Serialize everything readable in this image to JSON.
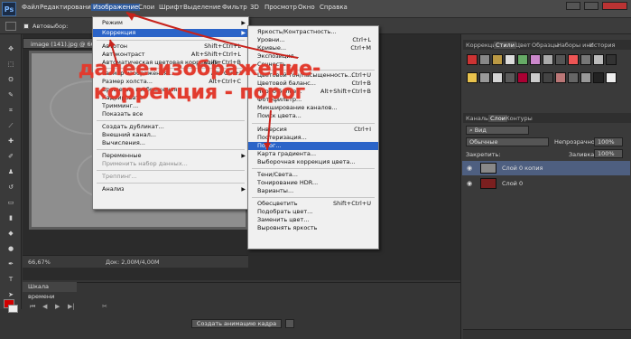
{
  "menubar": {
    "logo": "Ps",
    "items": [
      "Файл",
      "Редактирование",
      "Изображение",
      "Слои",
      "Шрифт",
      "Выделение",
      "Фильтр",
      "3D",
      "Просмотр",
      "Окно",
      "Справка"
    ]
  },
  "options": {
    "auto_select": "Автовыбор:"
  },
  "document": {
    "tab_title": "image (141).jpg @ 66,7",
    "zoom": "66,67%",
    "doc_size": "Док: 2,00М/4,00М"
  },
  "timeline": {
    "title": "Шкала времени",
    "create_button": "Создать анимацию кадра"
  },
  "image_menu": {
    "items": [
      {
        "label": "Режим",
        "shortcut": "",
        "arrow": true,
        "state": "normal"
      },
      {
        "label": "Коррекция",
        "shortcut": "",
        "arrow": true,
        "state": "highlight"
      },
      {
        "label": "Автотон",
        "shortcut": "Shift+Ctrl+L",
        "arrow": false,
        "state": "normal"
      },
      {
        "label": "Автоконтраст",
        "shortcut": "Alt+Shift+Ctrl+L",
        "arrow": false,
        "state": "normal"
      },
      {
        "label": "Автоматическая цветовая коррекция",
        "shortcut": "Shift+Ctrl+B",
        "arrow": false,
        "state": "normal"
      },
      {
        "label": "Размер изображения...",
        "shortcut": "Alt+Ctrl+I",
        "arrow": false,
        "state": "normal"
      },
      {
        "label": "Размер холста...",
        "shortcut": "Alt+Ctrl+C",
        "arrow": false,
        "state": "normal"
      },
      {
        "label": "Вращение изображения",
        "shortcut": "",
        "arrow": true,
        "state": "normal"
      },
      {
        "label": "Кадрировать",
        "shortcut": "",
        "arrow": false,
        "state": "normal"
      },
      {
        "label": "Тримминг...",
        "shortcut": "",
        "arrow": false,
        "state": "normal"
      },
      {
        "label": "Показать все",
        "shortcut": "",
        "arrow": false,
        "state": "normal"
      },
      {
        "label": "Создать дубликат...",
        "shortcut": "",
        "arrow": false,
        "state": "normal"
      },
      {
        "label": "Внешний канал...",
        "shortcut": "",
        "arrow": false,
        "state": "normal"
      },
      {
        "label": "Вычисления...",
        "shortcut": "",
        "arrow": false,
        "state": "normal"
      },
      {
        "label": "Переменные",
        "shortcut": "",
        "arrow": true,
        "state": "normal"
      },
      {
        "label": "Применить набор данных...",
        "shortcut": "",
        "arrow": false,
        "state": "disabled"
      },
      {
        "label": "Треппинг...",
        "shortcut": "",
        "arrow": false,
        "state": "disabled"
      },
      {
        "label": "Анализ",
        "shortcut": "",
        "arrow": true,
        "state": "normal"
      }
    ]
  },
  "correction_menu": {
    "items": [
      {
        "label": "Яркость/Контрастность...",
        "shortcut": "",
        "state": "normal"
      },
      {
        "label": "Уровни...",
        "shortcut": "Ctrl+L",
        "state": "normal"
      },
      {
        "label": "Кривые...",
        "shortcut": "Ctrl+M",
        "state": "normal"
      },
      {
        "label": "Экспозиция...",
        "shortcut": "",
        "state": "normal"
      },
      {
        "label": "Сочность...",
        "shortcut": "",
        "state": "normal"
      },
      {
        "label": "Цветовой тон/Насыщенность...",
        "shortcut": "Ctrl+U",
        "state": "normal"
      },
      {
        "label": "Цветовой баланс...",
        "shortcut": "Ctrl+B",
        "state": "normal"
      },
      {
        "label": "Черно-белое...",
        "shortcut": "Alt+Shift+Ctrl+B",
        "state": "normal"
      },
      {
        "label": "Фотофильтр...",
        "shortcut": "",
        "state": "normal"
      },
      {
        "label": "Микширование каналов...",
        "shortcut": "",
        "state": "normal"
      },
      {
        "label": "Поиск цвета...",
        "shortcut": "",
        "state": "normal"
      },
      {
        "label": "Инверсия",
        "shortcut": "Ctrl+I",
        "state": "normal"
      },
      {
        "label": "Постеризация...",
        "shortcut": "",
        "state": "normal"
      },
      {
        "label": "Порог...",
        "shortcut": "",
        "state": "highlight"
      },
      {
        "label": "Карта градиента...",
        "shortcut": "",
        "state": "normal"
      },
      {
        "label": "Выборочная коррекция цвета...",
        "shortcut": "",
        "state": "normal"
      },
      {
        "label": "Тени/Света...",
        "shortcut": "",
        "state": "normal"
      },
      {
        "label": "Тонирование HDR...",
        "shortcut": "",
        "state": "normal"
      },
      {
        "label": "Варианты...",
        "shortcut": "",
        "state": "normal"
      },
      {
        "label": "Обесцветить",
        "shortcut": "Shift+Ctrl+U",
        "state": "normal"
      },
      {
        "label": "Подобрать цвет...",
        "shortcut": "",
        "state": "normal"
      },
      {
        "label": "Заменить цвет...",
        "shortcut": "",
        "state": "normal"
      },
      {
        "label": "Выровнять яркость",
        "shortcut": "",
        "state": "normal"
      }
    ]
  },
  "annotation": {
    "text": "далее-изображение-коррекция - порог",
    "color": "#e23b2e"
  },
  "styles_panel": {
    "tabs": [
      "Коррекция",
      "Стили",
      "Цвет",
      "Образцы",
      "Наборы инс",
      "История"
    ],
    "active_tab": "Стили"
  },
  "layers_panel": {
    "tabs": [
      "Каналы",
      "Слои",
      "Контуры"
    ],
    "active_tab": "Слои",
    "kind_filter": "Вид",
    "blend_mode": "Обычные",
    "opacity_label": "Непрозрачность:",
    "opacity_value": "100%",
    "lock_label": "Закрепить:",
    "fill_label": "Заливка:",
    "fill_value": "100%",
    "layers": [
      {
        "name": "Слой 0 копия",
        "selected": true
      },
      {
        "name": "Слой 0",
        "selected": false
      }
    ]
  },
  "colors": {
    "accent_highlight": "#2b64c8",
    "foreground": "#d10000",
    "background": "#eeeeee"
  }
}
